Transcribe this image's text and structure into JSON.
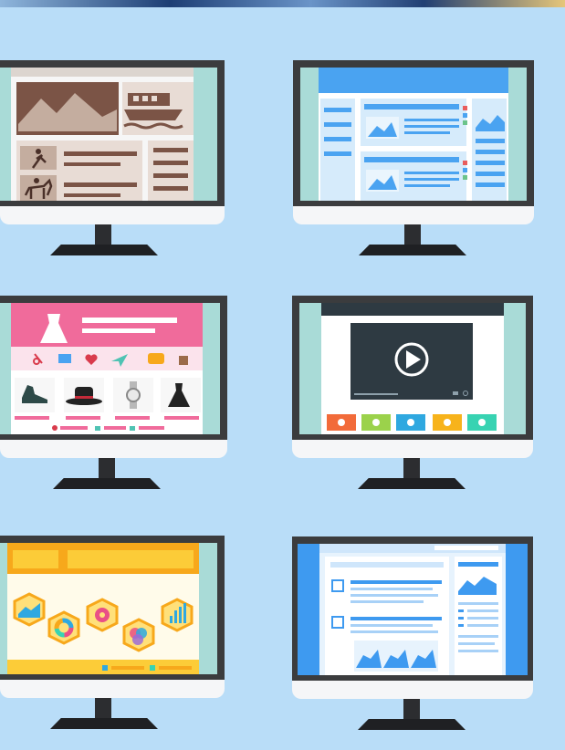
{
  "scene": {
    "description_visible_text": [],
    "background_color": "#b9ddf8",
    "accent_colors": {
      "bezel": "#3b3c3e",
      "stand": "#222326",
      "travel_brown": "#7b5446",
      "blog_blue": "#4aa3f1",
      "shop_pink": "#f06b9b",
      "video_dark": "#2e3a42",
      "infographic_orange": "#f7a81b",
      "docs_blue": "#3e9af0"
    }
  },
  "monitors": [
    {
      "theme": "travel-website",
      "icons": [
        "mountain-image-icon",
        "boat-icon",
        "skier-icon",
        "horse-rider-icon"
      ]
    },
    {
      "theme": "blog-layout",
      "icons": [
        "image-placeholder-icon",
        "image-placeholder-icon"
      ]
    },
    {
      "theme": "online-shop",
      "icons": [
        "dress-icon",
        "heart-icon",
        "paper-plane-icon",
        "shoe-icon",
        "hat-icon",
        "watch-icon",
        "dress-icon"
      ]
    },
    {
      "theme": "video-player",
      "icons": [
        "play-button-icon"
      ]
    },
    {
      "theme": "infographic-dashboard",
      "icons": [
        "chart-hexagon-icon",
        "donut-chart-icon",
        "bar-chart-icon"
      ]
    },
    {
      "theme": "documentation-page",
      "icons": [
        "checkbox-icon",
        "checkbox-icon"
      ]
    }
  ]
}
